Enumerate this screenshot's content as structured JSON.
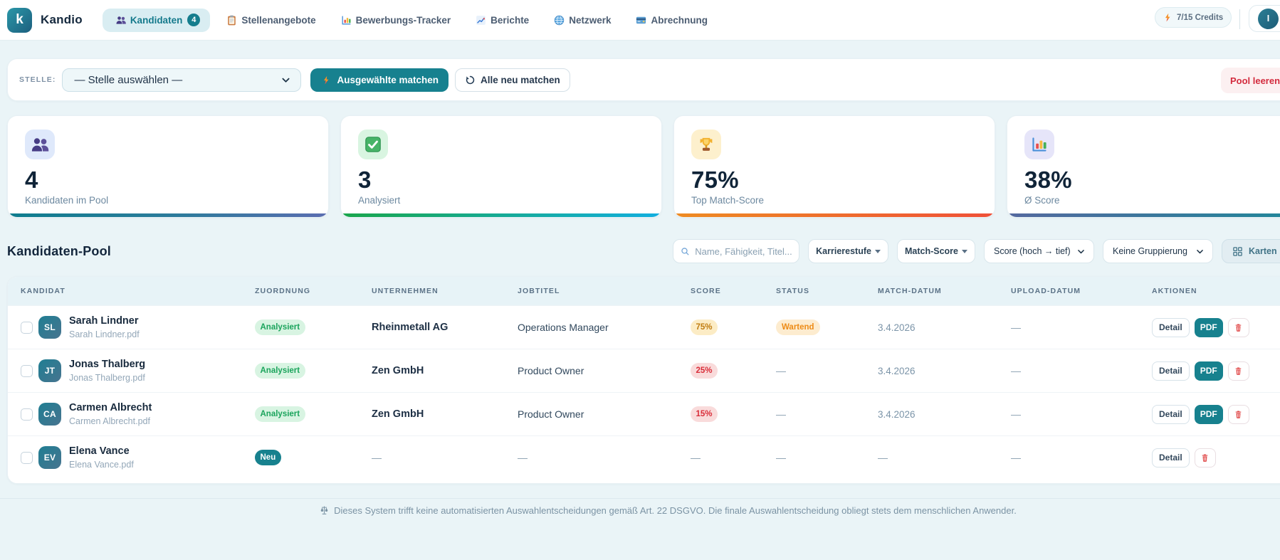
{
  "brand": {
    "logo_letter": "k",
    "name": "Kandio"
  },
  "nav": {
    "items": [
      {
        "label": "Kandidaten",
        "badge": "4",
        "active": true,
        "icon": "people"
      },
      {
        "label": "Stellenangebote",
        "icon": "clipboard"
      },
      {
        "label": "Bewerbungs-Tracker",
        "icon": "bar-chart"
      },
      {
        "label": "Berichte",
        "icon": "chart-increasing"
      },
      {
        "label": "Netzwerk",
        "icon": "globe"
      },
      {
        "label": "Abrechnung",
        "icon": "credit-card"
      }
    ]
  },
  "user": {
    "credits": "7/15 Credits",
    "avatar_initial": "I"
  },
  "toolbar": {
    "stelle_label": "STELLE:",
    "stelle_select_value": "— Stelle auswählen —",
    "match_selected_label": "Ausgewählte matchen",
    "rematch_all_label": "Alle neu matchen",
    "clear_pool_label": "Pool leeren"
  },
  "stats": [
    {
      "icon": "people",
      "value": "4",
      "label": "Kandidaten im Pool"
    },
    {
      "icon": "check",
      "value": "3",
      "label": "Analysiert"
    },
    {
      "icon": "trophy",
      "value": "75%",
      "label": "Top Match-Score"
    },
    {
      "icon": "bar-chart",
      "value": "38%",
      "label": "Ø Score"
    }
  ],
  "pool": {
    "title": "Kandidaten-Pool",
    "search_placeholder": "Name, Fähigkeit, Titel...",
    "filter_career": "Karrierestufe",
    "filter_score": "Match-Score",
    "sort_select_value": "Score (hoch → tief)",
    "group_select_value": "Keine Gruppierung",
    "view_toggle_label": "Karten"
  },
  "table": {
    "columns": [
      "KANDIDAT",
      "ZUORDNUNG",
      "UNTERNEHMEN",
      "JOBTITEL",
      "SCORE",
      "STATUS",
      "MATCH-DATUM",
      "UPLOAD-DATUM",
      "AKTIONEN"
    ],
    "rows": [
      {
        "initials": "SL",
        "name": "Sarah Lindner",
        "file": "Sarah Lindner.pdf",
        "zuordnung": "Analysiert",
        "company": "Rheinmetall AG",
        "job": "Operations Manager",
        "score": "75%",
        "status": "Wartend",
        "match_date": "3.4.2026",
        "upload_date": "—",
        "detail_label": "Detail",
        "pdf_label": "PDF"
      },
      {
        "initials": "JT",
        "name": "Jonas Thalberg",
        "file": "Jonas Thalberg.pdf",
        "zuordnung": "Analysiert",
        "company": "Zen GmbH",
        "job": "Product Owner",
        "score": "25%",
        "status": "—",
        "match_date": "3.4.2026",
        "upload_date": "—",
        "detail_label": "Detail",
        "pdf_label": "PDF"
      },
      {
        "initials": "CA",
        "name": "Carmen Albrecht",
        "file": "Carmen Albrecht.pdf",
        "zuordnung": "Analysiert",
        "company": "Zen GmbH",
        "job": "Product Owner",
        "score": "15%",
        "status": "—",
        "match_date": "3.4.2026",
        "upload_date": "—",
        "detail_label": "Detail",
        "pdf_label": "PDF"
      },
      {
        "initials": "EV",
        "name": "Elena Vance",
        "file": "Elena Vance.pdf",
        "zuordnung": "Neu",
        "company": "—",
        "job": "—",
        "score": "—",
        "status": "—",
        "match_date": "—",
        "upload_date": "—",
        "detail_label": "Detail"
      }
    ]
  },
  "footer": {
    "text": "Dieses System trifft keine automatisierten Auswahlentscheidungen gemäß Art. 22 DSGVO. Die finale Auswahlentscheidung obliegt stets dem menschlichen Anwender."
  }
}
